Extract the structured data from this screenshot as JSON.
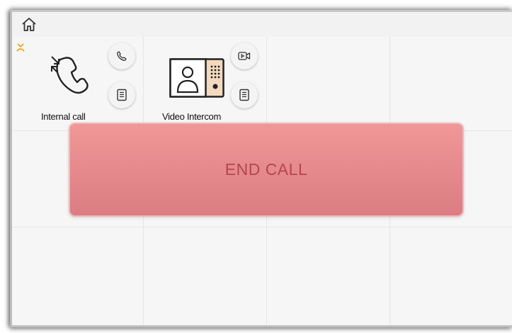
{
  "topbar": {
    "home_icon": "home-icon"
  },
  "tiles": [
    {
      "label": "Internal call",
      "main_icon": "handset-transfer-icon",
      "status_icon": "missed-call-icon",
      "buttons": [
        {
          "icon": "phone-icon"
        },
        {
          "icon": "log-list-icon"
        }
      ]
    },
    {
      "label": "Video Intercom",
      "main_icon": "video-door-station-icon",
      "buttons": [
        {
          "icon": "video-camera-icon"
        },
        {
          "icon": "log-list-icon"
        }
      ]
    }
  ],
  "overlay": {
    "end_call_label": "END CALL"
  },
  "colors": {
    "end_call_bg": "#e88c90",
    "end_call_text": "#b2474f",
    "status_accent": "#f0a500"
  }
}
